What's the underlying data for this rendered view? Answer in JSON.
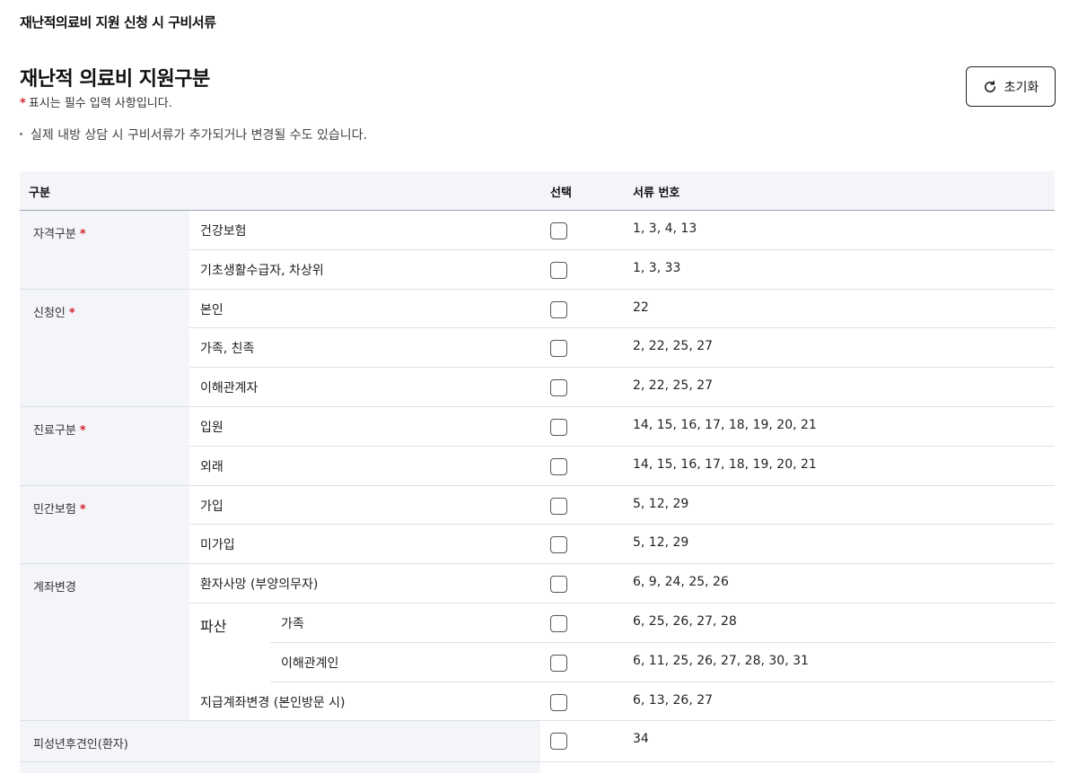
{
  "page": {
    "top_title": "재난적의료비 지원 신청 시 구비서류",
    "section_title": "재난적 의료비 지원구분",
    "required_star": "*",
    "required_note": "표시는 필수 입력 사항입니다.",
    "info_note": "실제 내방 상담 시 구비서류가 추가되거나 변경될 수도 있습니다.",
    "reset_label": "초기화",
    "reset_icon": "refresh-icon"
  },
  "table": {
    "headers": {
      "category": "구분",
      "select": "선택",
      "docs": "서류 번호"
    },
    "groups": [
      {
        "label": "자격구분",
        "required": true,
        "rows": [
          {
            "label": "건강보험",
            "docs": "1, 3, 4, 13"
          },
          {
            "label": "기초생활수급자, 차상위",
            "docs": "1, 3, 33"
          }
        ]
      },
      {
        "label": "신청인",
        "required": true,
        "rows": [
          {
            "label": "본인",
            "docs": "22"
          },
          {
            "label": "가족, 친족",
            "docs": "2, 22, 25, 27"
          },
          {
            "label": "이해관계자",
            "docs": "2, 22, 25, 27"
          }
        ]
      },
      {
        "label": "진료구분",
        "required": true,
        "rows": [
          {
            "label": "입원",
            "docs": "14, 15, 16, 17, 18, 19, 20, 21"
          },
          {
            "label": "외래",
            "docs": "14, 15, 16, 17, 18, 19, 20, 21"
          }
        ]
      },
      {
        "label": "민간보험",
        "required": true,
        "rows": [
          {
            "label": "가입",
            "docs": "5, 12, 29"
          },
          {
            "label": "미가입",
            "docs": "5, 12, 29"
          }
        ]
      },
      {
        "label": "계좌변경",
        "required": false,
        "rows": [
          {
            "label": "환자사망 (부양의무자)",
            "docs": "6, 9, 24, 25, 26"
          },
          {
            "label": "파산",
            "sub": "가족",
            "docs": "6, 25, 26, 27, 28"
          },
          {
            "label": "",
            "sub": "이해관계인",
            "docs": "6, 11, 25, 26, 27, 28, 30, 31"
          },
          {
            "label": "지급계좌변경 (본인방문 시)",
            "docs": "6, 13, 26, 27"
          }
        ]
      }
    ],
    "standalone": [
      {
        "label": "피성년후견인(환자)",
        "docs": "34"
      }
    ]
  }
}
